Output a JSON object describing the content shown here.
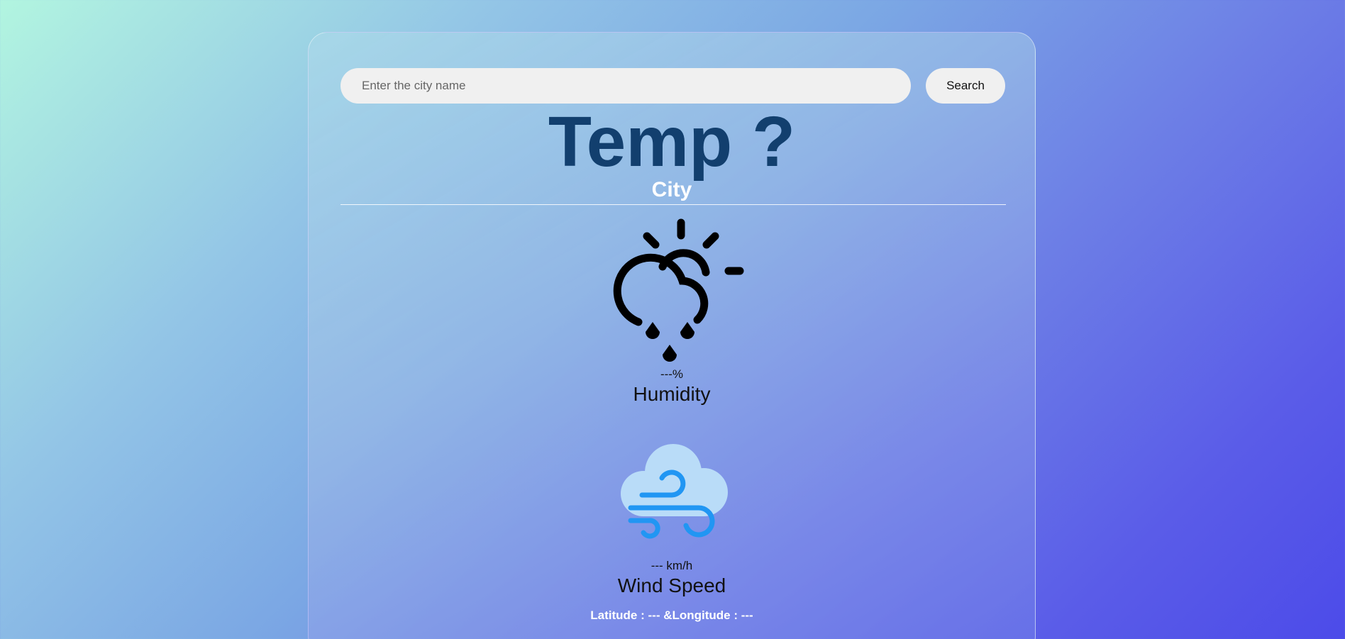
{
  "search": {
    "placeholder": "Enter the city name",
    "value": "",
    "button_label": "Search"
  },
  "weather": {
    "temp": "Temp ?",
    "city": "City",
    "condition_icon": "cloud-sun-rain-icon",
    "humidity_value": "---%",
    "humidity_label": "Humidity",
    "wind_icon": "wind-cloud-icon",
    "wind_value": "--- km/h",
    "wind_label": "Wind Speed",
    "coordinates": "Latitude : --- &Longitude : ---"
  },
  "colors": {
    "temp_text": "#123f6e",
    "wind_icon_cloud": "#b9dcf8",
    "wind_icon_lines": "#2196f3"
  }
}
